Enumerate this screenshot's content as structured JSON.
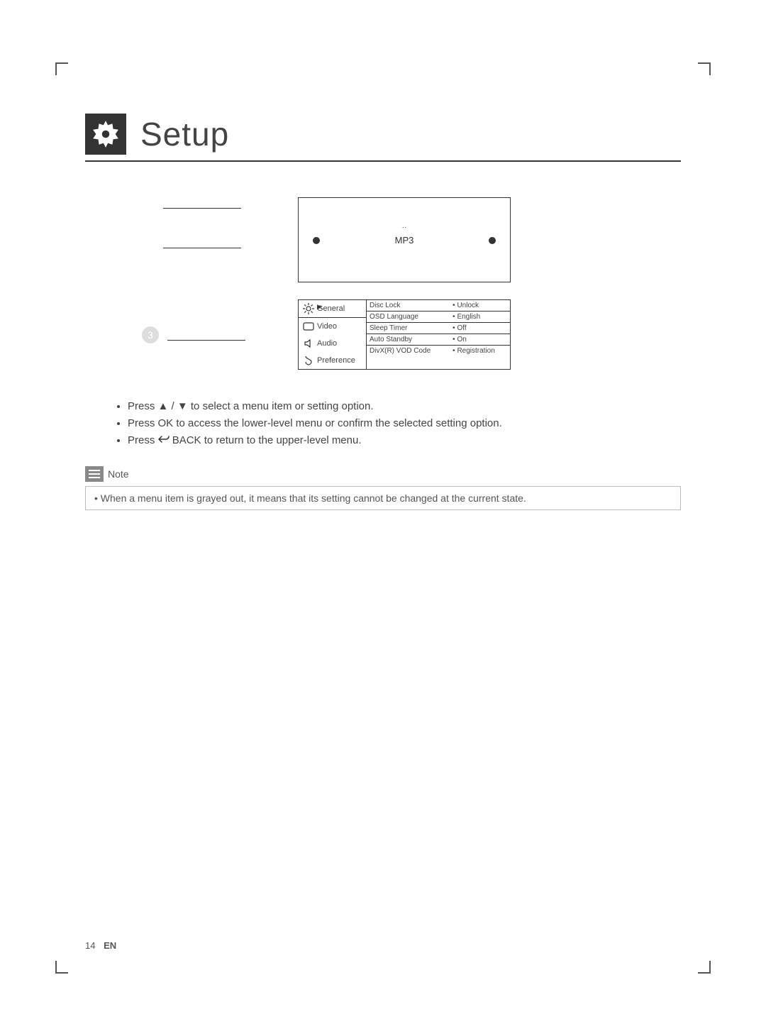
{
  "title": "Setup",
  "device": {
    "label": "MP3",
    "tiny": "··"
  },
  "step_num": "3",
  "menu": {
    "tabs": [
      "General",
      "Video",
      "Audio",
      "Preference"
    ],
    "items": [
      {
        "label": "Disc Lock",
        "value": "Unlock"
      },
      {
        "label": "OSD Language",
        "value": "English"
      },
      {
        "label": "Sleep Timer",
        "value": "Off"
      },
      {
        "label": "Auto Standby",
        "value": "On"
      },
      {
        "label": "DivX(R) VOD Code",
        "value": "Registration"
      }
    ]
  },
  "instructions": {
    "line1_pre": "Press ",
    "line1_post": " to select a menu item or setting option.",
    "arrows": "▲ / ▼",
    "line2_pre": "Press ",
    "line2_mid": "OK",
    "line2_post": " to access the lower-level menu or confirm the selected setting option.",
    "line3_pre": "Press ",
    "line3_mid": "BACK",
    "line3_post": " to return to the upper-level menu."
  },
  "note": {
    "header": "Note",
    "body": "When a menu item is grayed out, it means that its setting cannot be changed at the current state."
  },
  "footer": {
    "page": "14",
    "lang": "EN"
  }
}
